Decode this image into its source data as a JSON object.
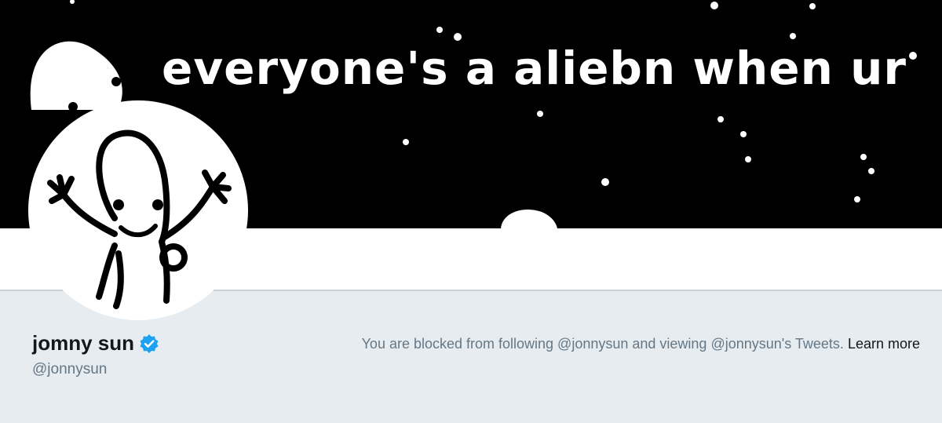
{
  "header": {
    "banner_text": "everyone's a aliebn when ur"
  },
  "profile": {
    "name": "jomny sun",
    "handle": "@jonnysun",
    "verified": true,
    "verified_color": "#1da1f2"
  },
  "notice": {
    "text": "You are blocked from following @jonnysun and viewing @jonnysun's Tweets.",
    "link_label": "Learn more"
  },
  "colors": {
    "banner_bg": "#000000",
    "page_bg": "#e6ecf0",
    "name": "#14171a",
    "secondary": "#657786"
  }
}
